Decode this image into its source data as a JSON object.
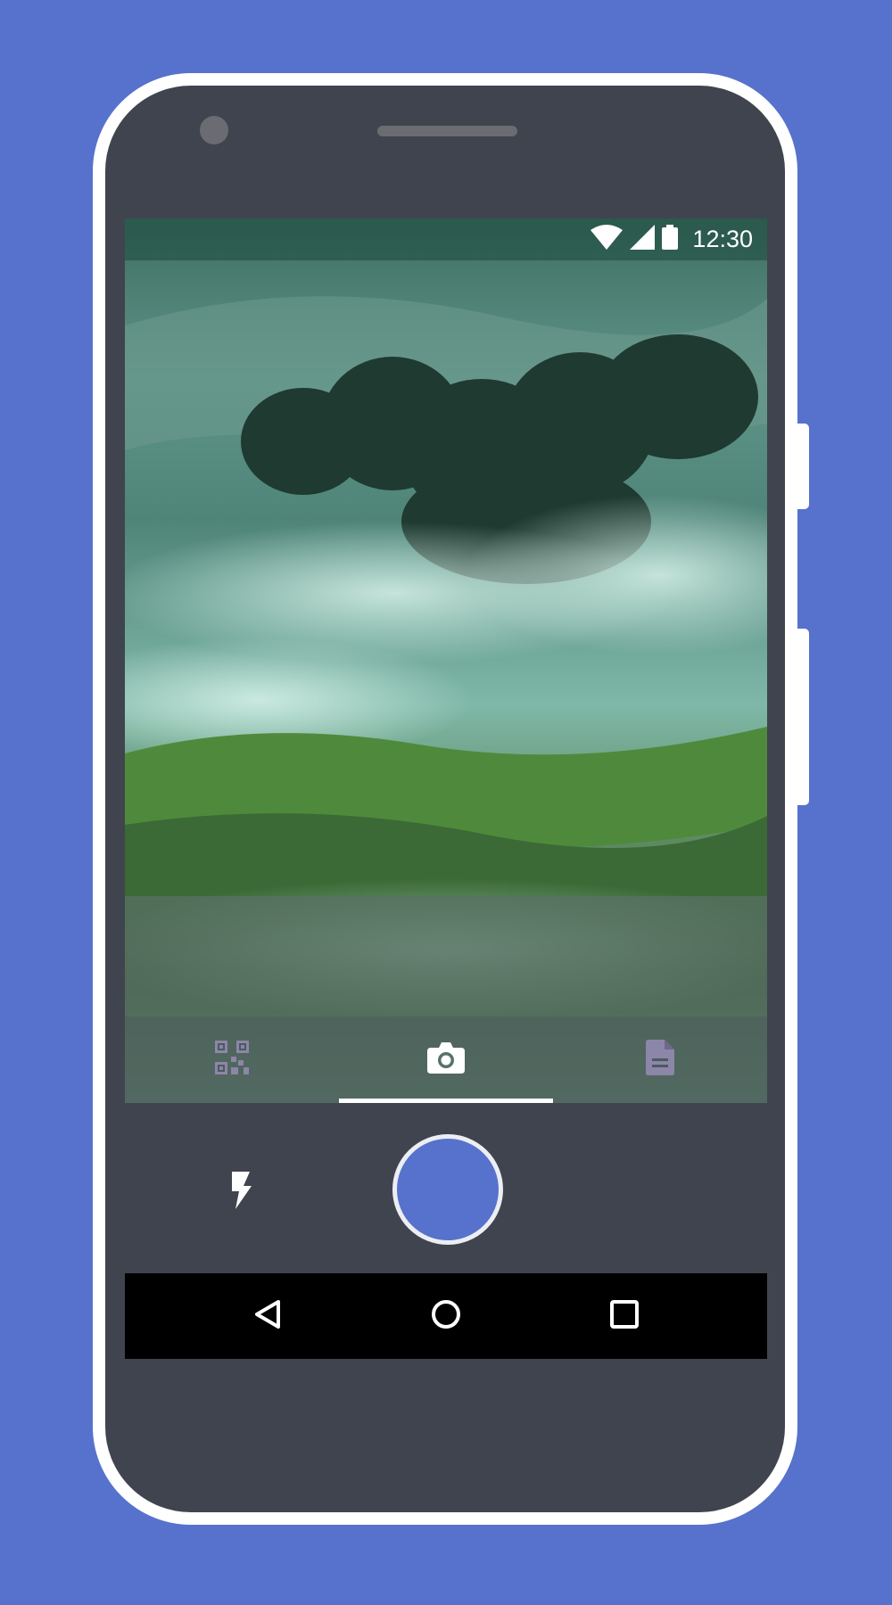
{
  "status_bar": {
    "time": "12:30",
    "icons": [
      "wifi-icon",
      "cellular-signal-icon",
      "battery-icon"
    ]
  },
  "tabs": [
    {
      "name": "qr-code",
      "icon": "qr-code-icon",
      "selected": false
    },
    {
      "name": "camera",
      "icon": "camera-icon",
      "selected": true
    },
    {
      "name": "document",
      "icon": "document-icon",
      "selected": false
    }
  ],
  "controls": {
    "flash_icon": "flash-icon",
    "shutter_icon": "shutter-button"
  },
  "nav": {
    "icons": [
      "back-icon",
      "home-icon",
      "recent-apps-icon"
    ]
  },
  "colors": {
    "background": "#5672cc",
    "phone_body": "#40444f",
    "phone_border": "#ffffff",
    "shutter": "#5672cc",
    "nav_bar": "#000000",
    "inactive_tab_icon": "#8c86a8"
  }
}
